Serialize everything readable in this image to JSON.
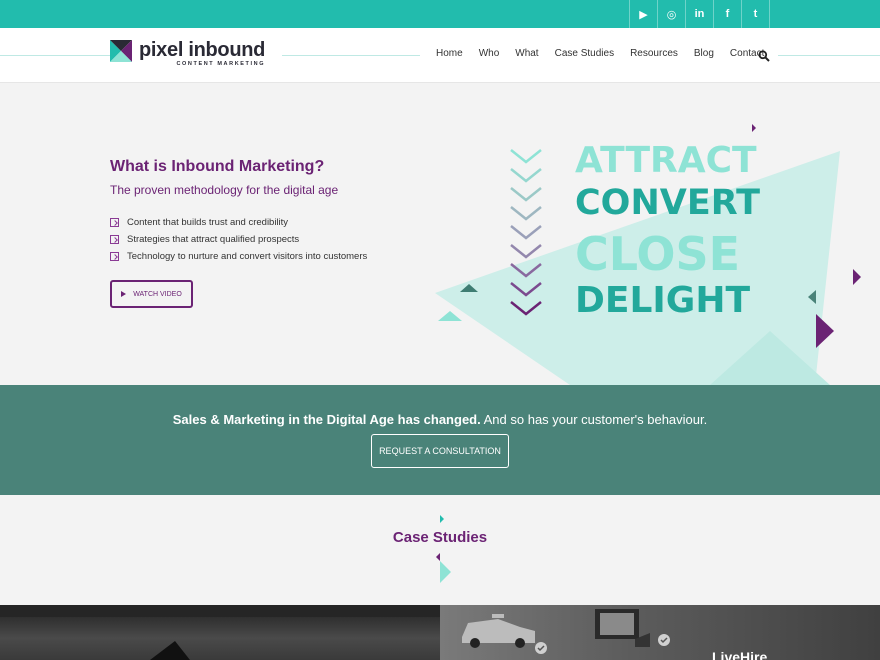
{
  "social": {
    "icons": [
      "youtube-icon",
      "instagram-icon",
      "linkedin-icon",
      "facebook-icon",
      "twitter-icon"
    ],
    "glyphs": [
      "▶",
      "◎",
      "in",
      "f",
      "t"
    ]
  },
  "brand": {
    "name": "pixel inbound",
    "tagline": "CONTENT MARKETING",
    "colors": {
      "teal": "#22bcad",
      "purple": "#6b2374",
      "green": "#4a8379",
      "mint": "#8ee3d5"
    }
  },
  "nav": {
    "items": [
      "Home",
      "Who",
      "What",
      "Case Studies",
      "Resources",
      "Blog",
      "Contact"
    ]
  },
  "hero": {
    "title": "What is Inbound Marketing?",
    "subtitle": "The proven methodology for the digital age",
    "bullets": [
      "Content that builds trust and credibility",
      "Strategies that attract qualified prospects",
      "Technology to nurture and convert visitors into customers"
    ],
    "watch_label": "WATCH VIDEO",
    "words": [
      "ATTRACT",
      "CONVERT",
      "CLOSE",
      "DELIGHT"
    ]
  },
  "band": {
    "bold": "Sales & Marketing in the Digital Age has changed.",
    "rest": " And so has your customer's behaviour.",
    "button": "REQUEST A CONSULTATION"
  },
  "case_studies": {
    "title": "Case Studies"
  },
  "tiles": {
    "right_label": "LiveHire"
  }
}
